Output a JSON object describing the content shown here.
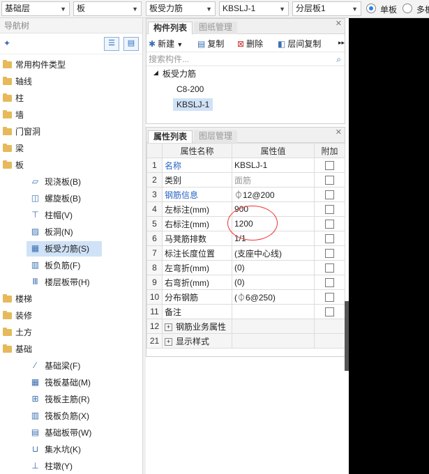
{
  "topbar": {
    "floor": "基础层",
    "category": "板",
    "type": "板受力筋",
    "component": "KBSLJ-1",
    "layer": "分层板1",
    "radio_single": "单板",
    "radio_multi": "多板"
  },
  "nav": {
    "title": "导航树",
    "items": [
      {
        "label": "常用构件类型"
      },
      {
        "label": "轴线"
      },
      {
        "label": "柱"
      },
      {
        "label": "墙"
      },
      {
        "label": "门窗洞"
      },
      {
        "label": "梁"
      },
      {
        "label": "板"
      },
      {
        "label": "现浇板(B)"
      },
      {
        "label": "螺旋板(B)"
      },
      {
        "label": "柱帽(V)"
      },
      {
        "label": "板洞(N)"
      },
      {
        "label": "板受力筋(S)"
      },
      {
        "label": "板负筋(F)"
      },
      {
        "label": "楼层板带(H)"
      },
      {
        "label": "楼梯"
      },
      {
        "label": "装修"
      },
      {
        "label": "土方"
      },
      {
        "label": "基础"
      },
      {
        "label": "基础梁(F)"
      },
      {
        "label": "筏板基础(M)"
      },
      {
        "label": "筏板主筋(R)"
      },
      {
        "label": "筏板负筋(X)"
      },
      {
        "label": "基础板带(W)"
      },
      {
        "label": "集水坑(K)"
      },
      {
        "label": "柱墩(Y)"
      }
    ]
  },
  "component_panel": {
    "tab_active": "构件列表",
    "tab_inactive": "图纸管理",
    "new": "新建",
    "copy": "复制",
    "delete": "删除",
    "floor_copy": "层间复制",
    "search_placeholder": "搜索构件...",
    "tree_root": "板受力筋",
    "children": [
      "C8-200",
      "KBSLJ-1"
    ]
  },
  "property_panel": {
    "tab_active": "属性列表",
    "tab_inactive": "图层管理",
    "headers": [
      "属性名称",
      "属性值",
      "附加"
    ],
    "rows": [
      {
        "num": "1",
        "name": "名称",
        "value": "KBSLJ-1"
      },
      {
        "num": "2",
        "name": "类别",
        "value": "面筋"
      },
      {
        "num": "3",
        "name": "钢筋信息",
        "value": "⏀12@200"
      },
      {
        "num": "4",
        "name": "左标注(mm)",
        "value": "900"
      },
      {
        "num": "5",
        "name": "右标注(mm)",
        "value": "1200"
      },
      {
        "num": "6",
        "name": "马凳筋排数",
        "value": "1/1"
      },
      {
        "num": "7",
        "name": "标注长度位置",
        "value": "(支座中心线)"
      },
      {
        "num": "8",
        "name": "左弯折(mm)",
        "value": "(0)"
      },
      {
        "num": "9",
        "name": "右弯折(mm)",
        "value": "(0)"
      },
      {
        "num": "10",
        "name": "分布钢筋",
        "value": "(⏀6@250)"
      },
      {
        "num": "11",
        "name": "备注",
        "value": ""
      },
      {
        "num": "12",
        "name": "钢筋业务属性",
        "value": ""
      },
      {
        "num": "21",
        "name": "显示样式",
        "value": ""
      }
    ]
  }
}
